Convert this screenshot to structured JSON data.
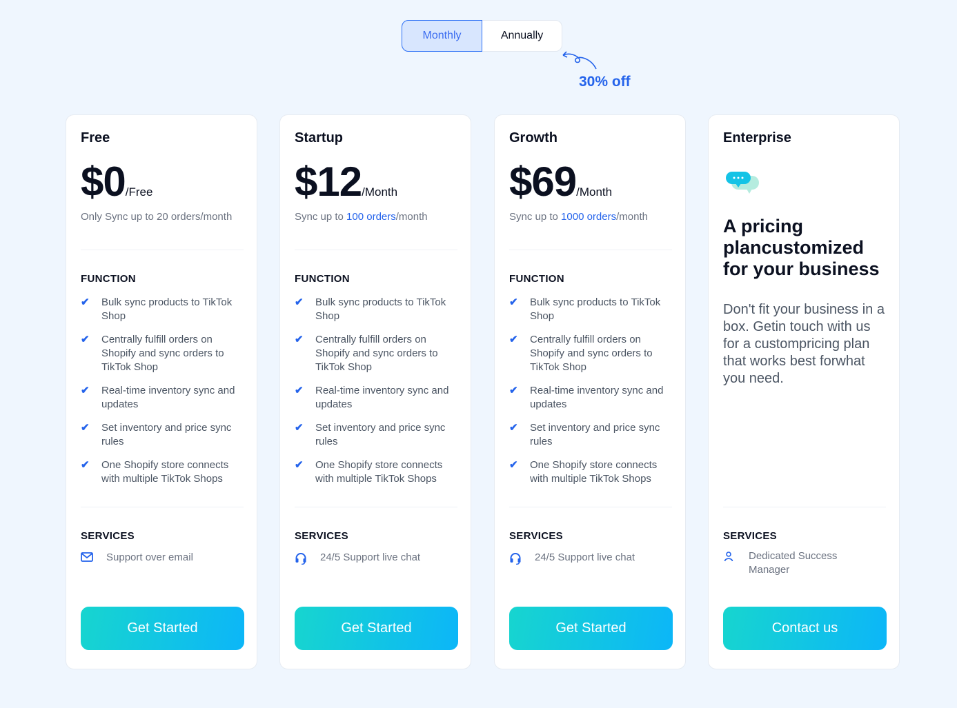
{
  "billing": {
    "options": [
      "Monthly",
      "Annually"
    ],
    "selected": "Monthly",
    "discount": "30% off"
  },
  "colors": {
    "accent": "#2463eb",
    "button_start": "#17d5cf",
    "button_end": "#0cb6f8"
  },
  "plans": [
    {
      "name": "Free",
      "price": "$0",
      "period": "/Free",
      "desc_pre": "Only Sync up to 20 orders/month",
      "desc_hl": "",
      "desc_post": "",
      "function_label": "FUNCTION",
      "features": [
        "Bulk sync products to TikTok Shop",
        "Centrally fulfill orders on Shopify and sync orders to TikTok Shop",
        "Real-time inventory sync and updates",
        "Set inventory and price sync rules",
        "One Shopify store connects with multiple TikTok Shops"
      ],
      "services_label": "SERVICES",
      "service": {
        "icon": "mail-icon",
        "text": "Support over email"
      },
      "cta": "Get Started"
    },
    {
      "name": "Startup",
      "price": "$12",
      "period": "/Month",
      "desc_pre": "Sync up to ",
      "desc_hl": "100 orders",
      "desc_post": "/month",
      "function_label": "FUNCTION",
      "features": [
        "Bulk sync products to TikTok Shop",
        "Centrally fulfill orders on Shopify and sync orders to TikTok Shop",
        "Real-time inventory sync and updates",
        "Set inventory and price sync rules",
        "One Shopify store connects with multiple TikTok Shops"
      ],
      "services_label": "SERVICES",
      "service": {
        "icon": "headset-icon",
        "text": "24/5 Support live chat"
      },
      "cta": "Get Started"
    },
    {
      "name": "Growth",
      "price": "$69",
      "period": "/Month",
      "desc_pre": "Sync up to ",
      "desc_hl": "1000 orders",
      "desc_post": "/month",
      "function_label": "FUNCTION",
      "features": [
        "Bulk sync products to TikTok Shop",
        "Centrally fulfill orders on Shopify and sync orders to TikTok Shop",
        "Real-time inventory sync and updates",
        "Set inventory and price sync rules",
        "One Shopify store connects with multiple TikTok Shops"
      ],
      "services_label": "SERVICES",
      "service": {
        "icon": "headset-icon",
        "text": "24/5 Support live chat"
      },
      "cta": "Get Started"
    }
  ],
  "enterprise": {
    "name": "Enterprise",
    "icon": "chat-bubbles-icon",
    "title": "A pricing plancustomized for your business",
    "desc": "Don't fit your business in a box. Getin touch with us for a custompricing plan that works best forwhat you need.",
    "services_label": "SERVICES",
    "service": {
      "icon": "user-icon",
      "text": "Dedicated Success Manager"
    },
    "cta": "Contact us"
  }
}
